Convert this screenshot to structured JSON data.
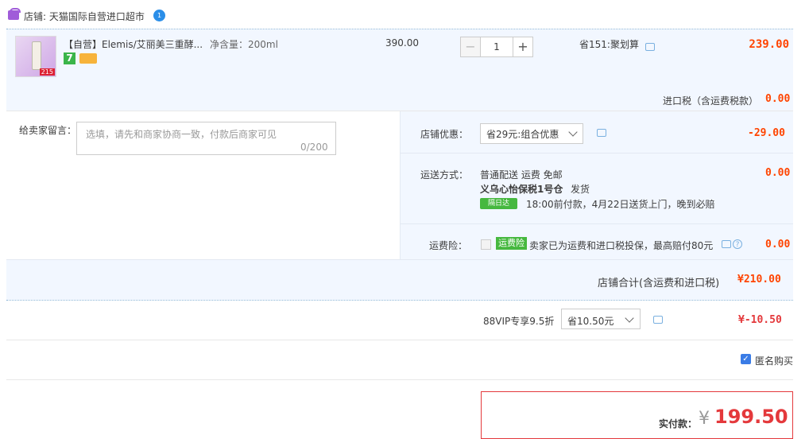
{
  "shop": {
    "label": "店铺: 天猫国际自营进口超市",
    "badge": "1"
  },
  "item": {
    "title": "【自营】Elemis/艾丽美三重酵...",
    "spec": "净含量：200ml",
    "thumb_tag": "215",
    "badge_seven": "7",
    "unit_price": "390.00",
    "quantity": "1",
    "minus": "−",
    "plus": "+",
    "saving": "省151:聚划算",
    "subtotal": "239.00",
    "tax_label": "进口税（含运费税款）",
    "tax_value": "0.00"
  },
  "note": {
    "label": "给卖家留言：",
    "placeholder": "选填，请先和商家协商一致，付款后商家可见",
    "count": "0/200"
  },
  "discount": {
    "label": "店铺优惠：",
    "selected": "省29元:组合优惠",
    "amount": "-29.00"
  },
  "shipping": {
    "label": "运送方式：",
    "method": "普通配送 运费 免邮",
    "warehouse": "义乌心怡保税1号仓",
    "ship_word": "发货",
    "next_day_tag": "隔日达",
    "delivery_note": "18:00前付款，4月22日送货上门，晚到必赔",
    "amount": "0.00"
  },
  "insurance": {
    "label": "运费险：",
    "tag": "运费险",
    "desc": "卖家已为运费和进口税投保，最高赔付80元",
    "qmark": "?",
    "amount": "0.00"
  },
  "shop_total": {
    "label": "店铺合计(含运费和进口税)",
    "amount": "¥210.00"
  },
  "vip": {
    "label": "88VIP专享9.5折",
    "selected": "省10.50元",
    "amount": "¥-10.50"
  },
  "anonymous": {
    "label": "匿名购买",
    "check": "✓"
  },
  "payment": {
    "label": "实付款：",
    "currency": "¥",
    "amount": "199.50"
  },
  "colors": {
    "accent": "#ff4400",
    "pay_red": "#e4393c",
    "panel_bg": "#f2f7ff",
    "green": "#46b83f"
  }
}
